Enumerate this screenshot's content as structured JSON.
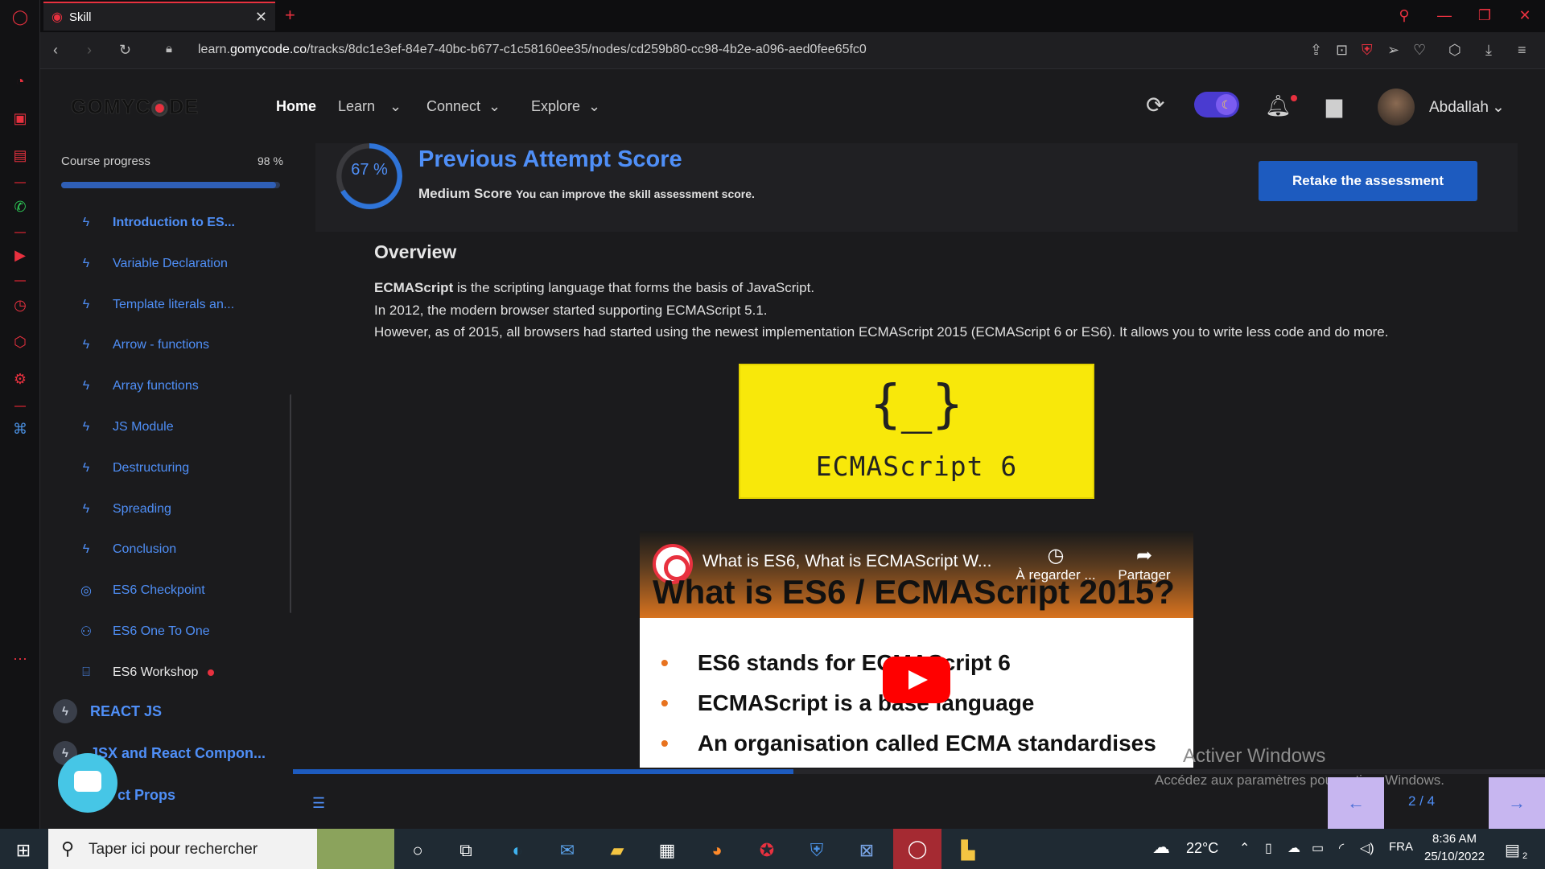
{
  "browser": {
    "tab_title": "Skill",
    "url_prefix": "learn.",
    "url_domain": "gomycode.co",
    "url_path": "/tracks/8dc1e3ef-84e7-40bc-b677-c1c58160ee35/nodes/cd259b80-cc98-4b2e-a096-aed0fee65fc0"
  },
  "header": {
    "logo_a": "GOMYC",
    "logo_b": "DE",
    "nav": [
      "Home",
      "Learn",
      "Connect",
      "Explore"
    ],
    "user_name": "Abdallah"
  },
  "sidebar": {
    "progress_label": "Course progress",
    "progress_value": "98 %",
    "progress_fraction": 0.98,
    "lessons": [
      {
        "label": "Introduction to ES...",
        "icon": "bolt-icon",
        "active": true
      },
      {
        "label": "Variable Declaration",
        "icon": "bolt-icon"
      },
      {
        "label": "Template literals an...",
        "icon": "bolt-icon"
      },
      {
        "label": "Arrow - functions",
        "icon": "bolt-icon"
      },
      {
        "label": "Array functions",
        "icon": "bolt-icon"
      },
      {
        "label": "JS Module",
        "icon": "bolt-icon"
      },
      {
        "label": "Destructuring",
        "icon": "bolt-icon"
      },
      {
        "label": "Spreading",
        "icon": "bolt-icon"
      },
      {
        "label": "Conclusion",
        "icon": "bolt-icon"
      },
      {
        "label": "ES6 Checkpoint",
        "icon": "target-icon"
      },
      {
        "label": "ES6 One To One",
        "icon": "people-icon"
      },
      {
        "label": "ES6 Workshop",
        "icon": "workshop-icon"
      }
    ],
    "modules": [
      "REACT JS",
      "JSX and React Compon...",
      "ct Props"
    ]
  },
  "score": {
    "percent_text": "67 %",
    "percent": 67,
    "title": "Previous Attempt Score",
    "level": "Medium Score",
    "hint": "You can improve the skill assessment score.",
    "retake_label": "Retake the assessment"
  },
  "overview": {
    "title": "Overview",
    "line1_bold": "ECMAScript",
    "line1_rest": " is the scripting language that forms the basis of JavaScript.",
    "line2": "In 2012, the modern browser started supporting ECMAScript 5.1.",
    "line3": "However, as of 2015, all browsers had started using the newest implementation ECMAScript 2015 (ECMAScript 6 or ES6). It allows you to write less code and do more.",
    "image_braces": "{_}",
    "image_label": "ECMAScript 6"
  },
  "video": {
    "title": "What is ES6, What is ECMAScript W...",
    "big_heading": "What is ES6 / ECMAScript 2015?",
    "watch_later": "À regarder ...",
    "share": "Partager",
    "bullets": [
      "ES6 stands for ECMAScript 6",
      "ECMAScript is a base language",
      "An organisation called ECMA standardises"
    ]
  },
  "pager": {
    "count": "2 / 4"
  },
  "watermark": {
    "line1": "Activer Windows",
    "line2": "Accédez aux paramètres pour activer Windows."
  },
  "taskbar": {
    "search_placeholder": "Taper ici pour rechercher",
    "weather": "22°C",
    "lang": "FRA",
    "time": "8:36 AM",
    "date": "25/10/2022",
    "notif_count": "2"
  }
}
